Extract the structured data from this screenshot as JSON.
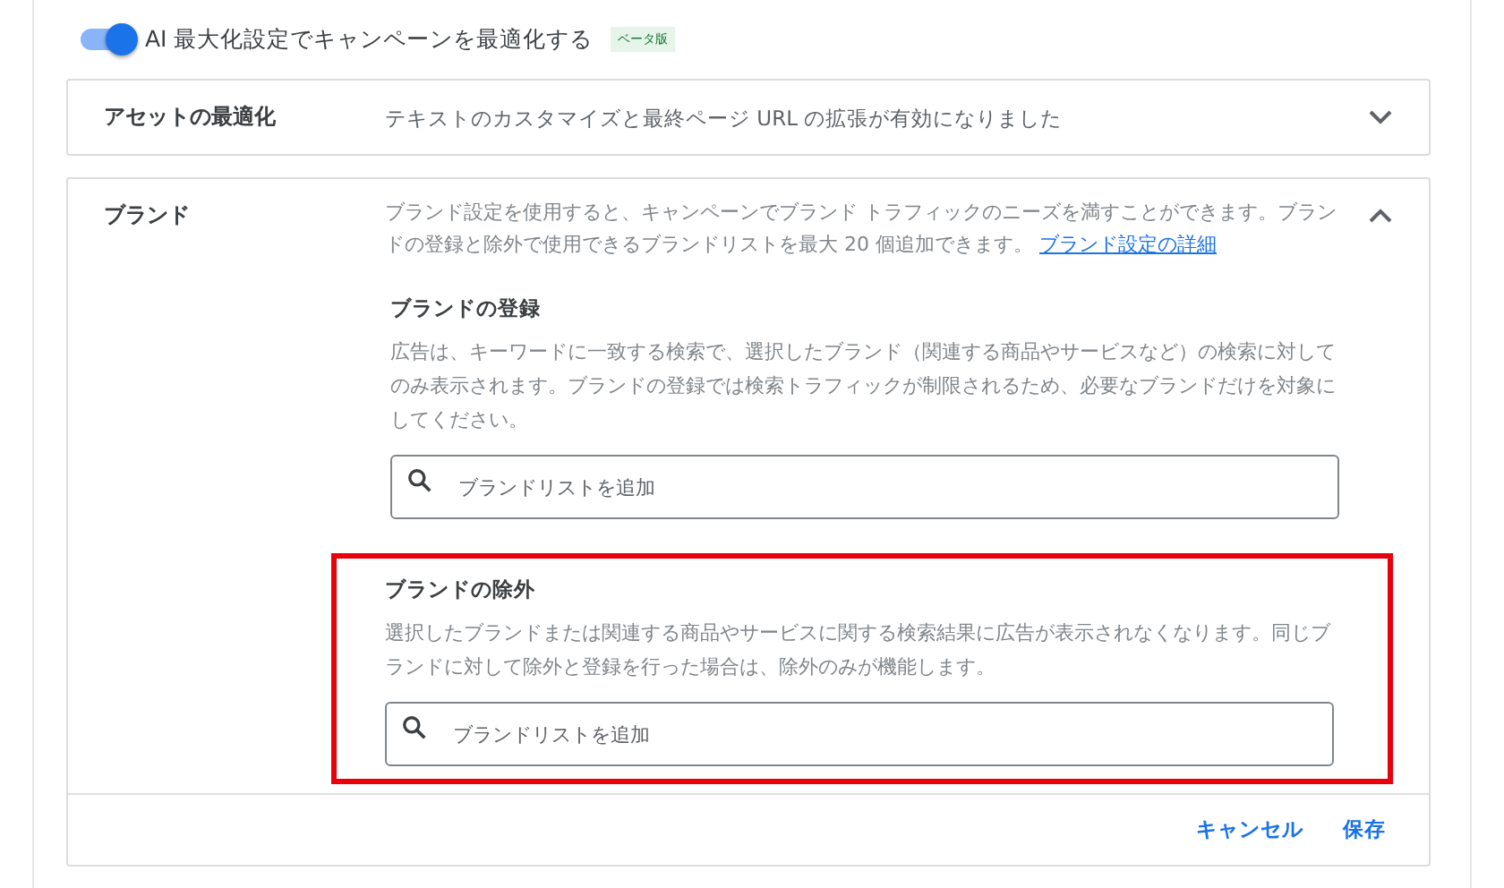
{
  "ai_toggle": {
    "label": "AI 最大化設定でキャンペーンを最適化する",
    "on": true,
    "badge": "ベータ版"
  },
  "sections": [
    {
      "title": "アセットの最適化",
      "summary": "テキストのカスタマイズと最終ページ URL の拡張が有効になりました",
      "expanded": false
    },
    {
      "title": "ブランド",
      "description": "ブランド設定を使用すると、キャンペーンでブランド トラフィックのニーズを満すことができます。ブランドの登録と除外で使用できるブランドリストを最大 20 個追加できます。",
      "link": "ブランド設定の詳細",
      "expanded": true,
      "groups": [
        {
          "heading": "ブランドの登録",
          "text": "広告は、キーワードに一致する検索で、選択したブランド（関連する商品やサービスなど）の検索に対してのみ表示されます。ブランドの登録では検索トラフィックが制限されるため、必要なブランドだけを対象にしてください。",
          "placeholder": "ブランドリストを追加",
          "highlighted": false
        },
        {
          "heading": "ブランドの除外",
          "text": "選択したブランドまたは関連する商品やサービスに関する検索結果に広告が表示されなくなります。同じブランドに対して除外と登録を行った場合は、除外のみが機能します。",
          "placeholder": "ブランドリストを追加",
          "highlighted": true
        }
      ],
      "buttons": [
        "キャンセル",
        "保存"
      ]
    }
  ]
}
